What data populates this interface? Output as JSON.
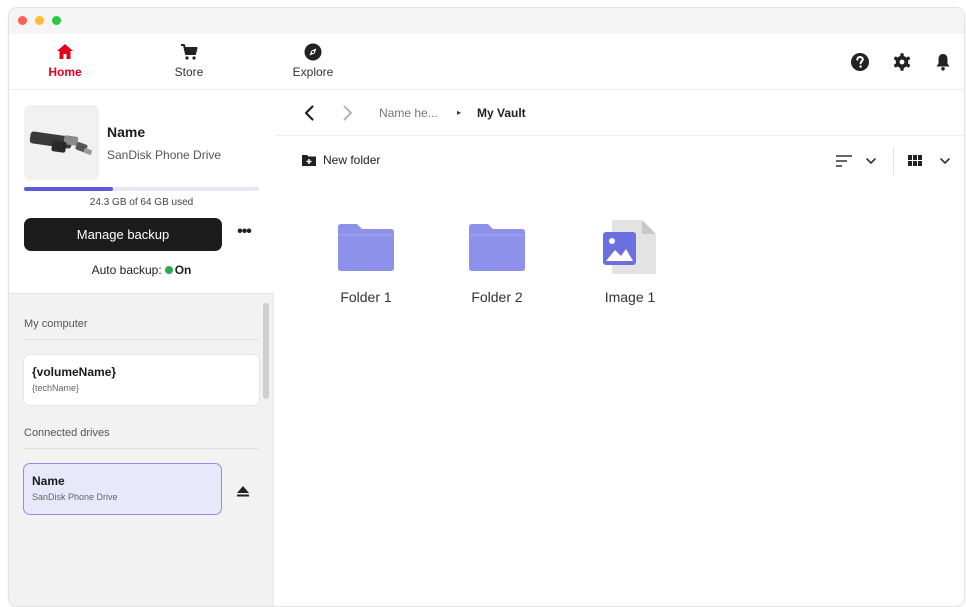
{
  "nav": {
    "items": [
      {
        "label": "Home",
        "icon": "home-icon",
        "active": true
      },
      {
        "label": "Store",
        "icon": "cart-icon",
        "active": false
      },
      {
        "label": "Explore",
        "icon": "compass-icon",
        "active": false
      }
    ],
    "right_icons": [
      "help-icon",
      "gear-icon",
      "bell-icon"
    ],
    "accent_color": "#e2001a"
  },
  "drive": {
    "name": "Name",
    "model": "SanDisk Phone Drive",
    "usage_text": "24.3 GB of 64 GB used",
    "usage_fraction": 0.38,
    "manage_label": "Manage backup",
    "more_label": "•••",
    "autobackup_label": "Auto backup:",
    "autobackup_state": "On"
  },
  "sidebar": {
    "my_computer_label": "My computer",
    "volume": {
      "name": "{volumeName}",
      "tech": "{techName}"
    },
    "connected_label": "Connected drives",
    "connected": {
      "name": "Name",
      "model": "SanDisk Phone Drive"
    }
  },
  "breadcrumb": {
    "parent": "Name he...",
    "separator": "▸",
    "current": "My Vault"
  },
  "toolbar": {
    "new_folder_label": "New folder"
  },
  "items": [
    {
      "label": "Folder 1",
      "type": "folder"
    },
    {
      "label": "Folder 2",
      "type": "folder"
    },
    {
      "label": "Image 1",
      "type": "image"
    }
  ],
  "colors": {
    "folder": "#8e91ea",
    "usage_fill": "#5b5bd6",
    "selected_card_border": "#8d8ee6",
    "status_on": "#2fa84f"
  }
}
